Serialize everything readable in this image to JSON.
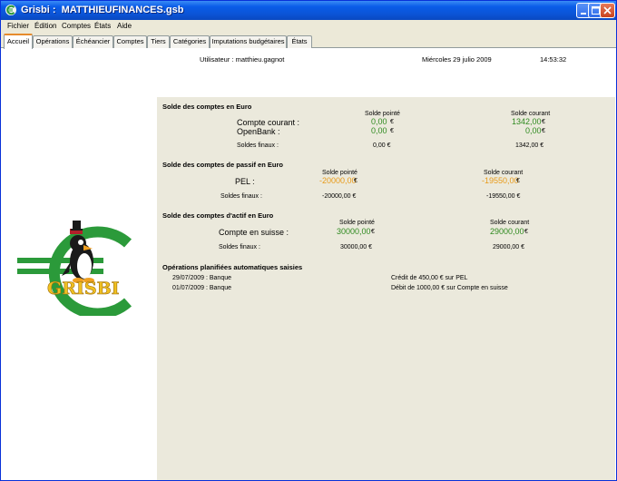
{
  "window": {
    "title": "Grisbi :  MATTHIEUFINANCES.gsb"
  },
  "menu": [
    "Fichier",
    "Édition",
    "Comptes",
    "États",
    "Aide"
  ],
  "tabs": [
    "Accueil",
    "Opérations",
    "Échéancier",
    "Comptes",
    "Tiers",
    "Catégories",
    "Imputations budgétaires",
    "États"
  ],
  "info": {
    "user": "Utilisateur : matthieu.gagnot",
    "date": "Miércoles 29 julio 2009",
    "time": "14:53:32"
  },
  "logo": {
    "text": "GRISBI"
  },
  "sections": {
    "euro": {
      "heading": "Solde des comptes en Euro",
      "col_pointe": "Solde pointé",
      "col_courant": "Solde courant",
      "rows": [
        {
          "name": "Compte courant :",
          "pointe": "0,00",
          "courant": "1342,00"
        },
        {
          "name": "OpenBank :",
          "pointe": "0,00",
          "courant": "0,00"
        }
      ],
      "totals": {
        "label": "Soldes finaux :",
        "pointe": "0,00 €",
        "courant": "1342,00 €"
      }
    },
    "passif": {
      "heading": "Solde des comptes de passif en Euro",
      "col_pointe": "Solde pointé",
      "col_courant": "Solde courant",
      "rows": [
        {
          "name": "PEL :",
          "pointe": "-20000,00",
          "courant": "-19550,00"
        }
      ],
      "totals": {
        "label": "Soldes finaux :",
        "pointe": "-20000,00 €",
        "courant": "-19550,00 €"
      }
    },
    "actif": {
      "heading": "Solde des comptes d'actif en Euro",
      "col_pointe": "Solde pointé",
      "col_courant": "Solde courant",
      "rows": [
        {
          "name": "Compte en suisse :",
          "pointe": "30000,00",
          "courant": "29000,00"
        }
      ],
      "totals": {
        "label": "Soldes finaux :",
        "pointe": "30000,00 €",
        "courant": "29000,00 €"
      }
    },
    "planned": {
      "heading": "Opérations planifiées automatiques saisies",
      "items": [
        {
          "date": "29/07/2009 : Banque",
          "desc": "Crédit de 450,00 € sur PEL"
        },
        {
          "date": "01/07/2009 : Banque",
          "desc": "Débit de 1000,00 € sur Compte en suisse"
        }
      ]
    }
  },
  "currency_symbol": "€",
  "colors": {
    "titlebar": "#0a5ce8",
    "panel": "#ebe9dc",
    "positive": "#2f8a1f",
    "negative": "#e89a18",
    "logo_green": "#2b9a3a"
  },
  "icons": [
    "grisbi-app-icon",
    "minimize-icon",
    "maximize-icon",
    "close-icon",
    "grisbi-penguin-logo"
  ]
}
